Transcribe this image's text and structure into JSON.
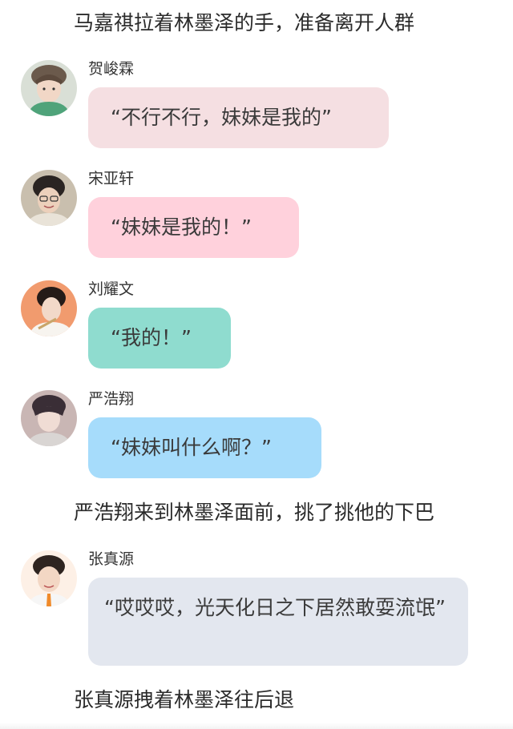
{
  "narration": {
    "line1": "马嘉祺拉着林墨泽的手，准备离开人群",
    "line2": "严浩翔来到林墨泽面前，挑了挑他的下巴",
    "line3": "张真源拽着林墨泽往后退"
  },
  "messages": [
    {
      "name": "贺峻霖",
      "text": "“不行不行，妹妹是我的”",
      "bubble_color": "#f5dfe2"
    },
    {
      "name": "宋亚轩",
      "text": "“妹妹是我的！”",
      "bubble_color": "#ffd1dc"
    },
    {
      "name": "刘耀文",
      "text": "“我的！”",
      "bubble_color": "#8fdccf"
    },
    {
      "name": "严浩翔",
      "text": "“妹妹叫什么啊？”",
      "bubble_color": "#a6dcfb"
    },
    {
      "name": "张真源",
      "text": "“哎哎哎，光天化日之下居然敢耍流氓”",
      "bubble_color": "#e3e7ef"
    }
  ],
  "avatars": [
    "avatar-photo-1",
    "avatar-photo-2",
    "avatar-photo-3",
    "avatar-photo-4",
    "avatar-photo-5"
  ]
}
